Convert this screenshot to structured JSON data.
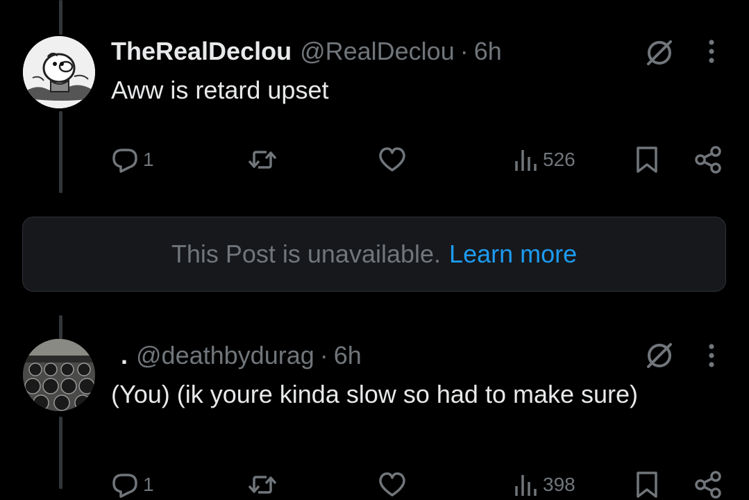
{
  "posts": [
    {
      "display_name": "TheRealDeclou",
      "handle": "@RealDeclou",
      "separator": "·",
      "time": "6h",
      "text": "Aww is retard upset",
      "reply_count": "1",
      "views": "526",
      "avatar_icon": "cartoon-creature-avatar"
    },
    {
      "display_name": ".",
      "handle": "@deathbydurag",
      "separator": "·",
      "time": "6h",
      "text": "(You) (ik youre kinda slow so had to make sure)",
      "reply_count": "1",
      "views": "398",
      "avatar_icon": "gym-dumbbells-avatar"
    }
  ],
  "unavailable": {
    "message": "This Post is unavailable.",
    "link": "Learn more"
  },
  "icons": {
    "muted": "no-symbol-icon",
    "more": "more-vertical-icon",
    "reply": "reply-icon",
    "repost": "repost-icon",
    "like": "heart-icon",
    "views": "views-bar-chart-icon",
    "bookmark": "bookmark-icon",
    "share": "share-icon"
  },
  "colors": {
    "background": "#000000",
    "text": "#e7e9ea",
    "muted_text": "#71767b",
    "link": "#1d9bf0",
    "card_bg": "#16181c"
  }
}
